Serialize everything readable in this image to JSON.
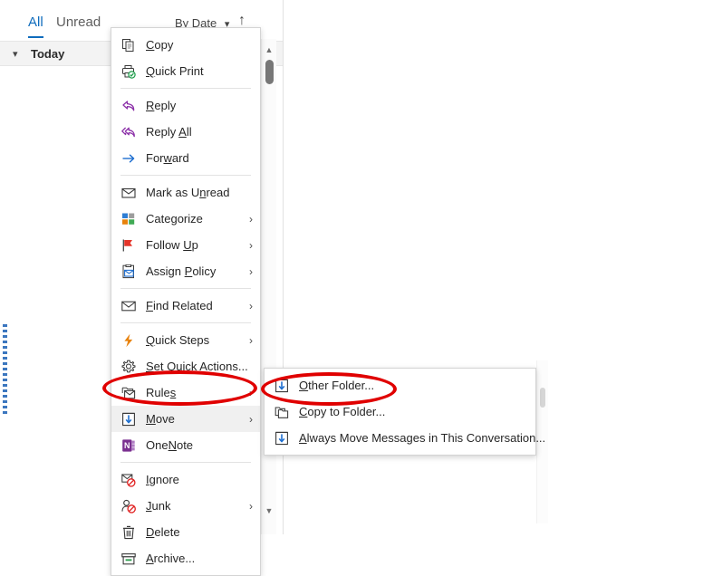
{
  "list_pane": {
    "filter_tabs": [
      {
        "label": "All",
        "active": true
      },
      {
        "label": "Unread",
        "active": false
      }
    ],
    "sort": {
      "label": "By Date",
      "chevron": "chevron-down-icon",
      "order_arrow": "↑"
    },
    "group_header": {
      "chevron": "chevron-down-icon",
      "label": "Today"
    },
    "scrollbar": {
      "up_arrow": "▲",
      "down_arrow": "▼"
    }
  },
  "context_menu": {
    "items": [
      {
        "id": "copy",
        "label": "Copy",
        "mnemonic": "C",
        "icon": "copy-icon",
        "submenu": false
      },
      {
        "id": "quick-print",
        "label": "Quick Print",
        "mnemonic": "Q",
        "icon": "quick-print-icon",
        "submenu": false
      },
      {
        "id": "sep-1",
        "separator": true
      },
      {
        "id": "reply",
        "label": "Reply",
        "mnemonic": "R",
        "icon": "reply-icon",
        "submenu": false
      },
      {
        "id": "reply-all",
        "label": "Reply All",
        "mnemonic": "A",
        "icon": "reply-all-icon",
        "submenu": false
      },
      {
        "id": "forward",
        "label": "Forward",
        "mnemonic": "w",
        "icon": "forward-icon",
        "submenu": false
      },
      {
        "id": "sep-2",
        "separator": true
      },
      {
        "id": "mark-as-unread",
        "label": "Mark as Unread",
        "mnemonic": "n",
        "icon": "envelope-icon",
        "submenu": false
      },
      {
        "id": "categorize",
        "label": "Categorize",
        "mnemonic": "g",
        "icon": "categorize-icon",
        "submenu": true
      },
      {
        "id": "follow-up",
        "label": "Follow Up",
        "mnemonic": "U",
        "icon": "flag-icon",
        "submenu": true
      },
      {
        "id": "assign-policy",
        "label": "Assign Policy",
        "mnemonic": "P",
        "icon": "assign-policy-icon",
        "submenu": true
      },
      {
        "id": "sep-3",
        "separator": true
      },
      {
        "id": "find-related",
        "label": "Find Related",
        "mnemonic": "F",
        "icon": "find-related-icon",
        "submenu": true
      },
      {
        "id": "sep-4",
        "separator": true
      },
      {
        "id": "quick-steps",
        "label": "Quick Steps",
        "mnemonic": "Q",
        "icon": "lightning-icon",
        "submenu": true
      },
      {
        "id": "set-quick-actions",
        "label": "Set Quick Actions...",
        "mnemonic": "S",
        "icon": "gear-icon",
        "submenu": false
      },
      {
        "id": "rules",
        "label": "Rules",
        "mnemonic": "s",
        "icon": "rules-icon",
        "submenu": true
      },
      {
        "id": "move",
        "label": "Move",
        "mnemonic": "M",
        "icon": "move-icon",
        "submenu": true,
        "hovered": true,
        "annotated": true
      },
      {
        "id": "onenote",
        "label": "OneNote",
        "mnemonic": "N",
        "icon": "onenote-icon",
        "submenu": false
      },
      {
        "id": "sep-5",
        "separator": true
      },
      {
        "id": "ignore",
        "label": "Ignore",
        "mnemonic": "I",
        "icon": "ignore-icon",
        "submenu": false
      },
      {
        "id": "junk",
        "label": "Junk",
        "mnemonic": "J",
        "icon": "junk-icon",
        "submenu": true
      },
      {
        "id": "delete",
        "label": "Delete",
        "mnemonic": "D",
        "icon": "delete-icon",
        "submenu": false
      },
      {
        "id": "archive",
        "label": "Archive...",
        "mnemonic": "A",
        "icon": "archive-icon",
        "submenu": false
      }
    ]
  },
  "move_submenu": {
    "items": [
      {
        "id": "other-folder",
        "label": "Other Folder...",
        "mnemonic": "O",
        "icon": "move-icon",
        "annotated": true
      },
      {
        "id": "copy-to-folder",
        "label": "Copy to Folder...",
        "mnemonic": "C",
        "icon": "copy-folder-icon"
      },
      {
        "id": "always-move",
        "label": "Always Move Messages in This Conversation...",
        "mnemonic": "A",
        "icon": "move-icon"
      }
    ]
  },
  "annotations": {
    "color": "#e00000",
    "targets": [
      "move",
      "other-folder"
    ]
  },
  "colors": {
    "accent_blue": "#0f6cbd",
    "reply_purple": "#8b2fa8",
    "forward_blue": "#1f6fd0",
    "flag_red": "#e5352a",
    "lightning_orange": "#e8820c",
    "onenote_purple": "#7a2f8f",
    "archive_green": "#2e9e4f",
    "annotation_red": "#e00000",
    "menu_bg": "#ffffff",
    "hover_bg": "#f0f0f0"
  }
}
